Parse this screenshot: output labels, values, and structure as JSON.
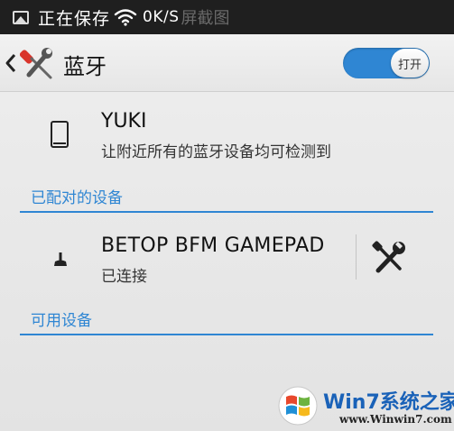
{
  "status_bar": {
    "saving_text": "正在保存",
    "speed_text": "0K/S",
    "ghost_text": "屏截图"
  },
  "action_bar": {
    "title": "蓝牙",
    "toggle_label": "打开",
    "toggle_on": true
  },
  "this_device": {
    "name": "YUKI",
    "description": "让附近所有的蓝牙设备均可检测到"
  },
  "paired_section": {
    "header": "已配对的设备",
    "devices": [
      {
        "name": "BETOP BFM GAMEPAD",
        "status": "已连接"
      }
    ]
  },
  "available_section": {
    "header": "可用设备"
  },
  "watermark": {
    "title": "Win7系统之家",
    "url": "www.Winwin7.com"
  },
  "colors": {
    "accent": "#2f86d3",
    "status_bar_bg": "#1f1f1f"
  },
  "icons": [
    "image-icon",
    "wifi-icon",
    "back-icon",
    "settings-logo-icon",
    "phone-icon",
    "gamepad-icon",
    "wrench-screwdriver-icon",
    "windows-logo-icon"
  ]
}
